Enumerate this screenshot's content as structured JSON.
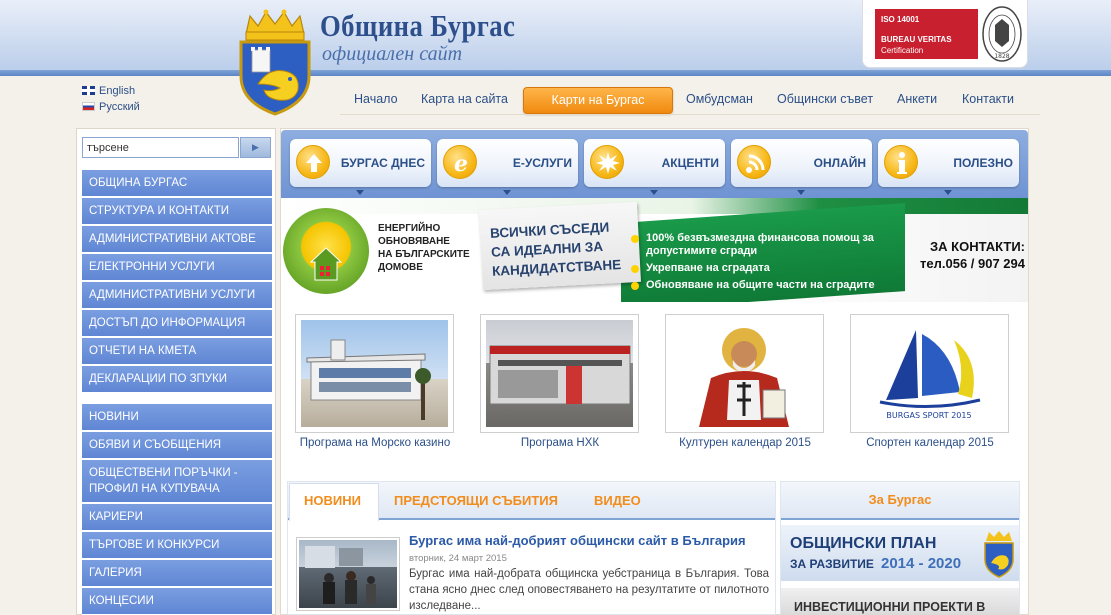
{
  "header": {
    "title": "Община Бургас",
    "subtitle": "официален сайт",
    "iso": {
      "line1": "ISO 14001",
      "line2": "BUREAU VERITAS",
      "line3": "Certification",
      "seal_year": "1828",
      "red": "#c8202f"
    }
  },
  "languages": [
    {
      "label": "English",
      "icon": "uk-flag-icon"
    },
    {
      "label": "Русский",
      "icon": "russia-flag-icon"
    }
  ],
  "topnav": {
    "items": [
      "Начало",
      "Карта на сайта",
      "Карти на Бургас",
      "Омбудсман",
      "Общински съвет",
      "Анкети",
      "Контакти"
    ],
    "highlight_color": "#f08a0f"
  },
  "search": {
    "value": "търсене",
    "button_icon": "arrow-right-icon"
  },
  "sidebar": {
    "group1": [
      "Община Бургас",
      "Структура и контакти",
      "Административни актове",
      "Електронни услуги",
      "Административни услуги",
      "Достъп до информация",
      "Отчети на кмета",
      "Декларации по ЗПУКИ"
    ],
    "group2": [
      "Новини",
      "Обяви и съобщения",
      "Обществени поръчки - профил на купувача",
      "Кариери",
      "Търгове и конкурси",
      "Галерия",
      "Концесии"
    ],
    "accent": "#6a8fd9"
  },
  "categories": [
    {
      "label": "Бургас днес",
      "icon": "arrow-up-icon"
    },
    {
      "label": "E-услуги",
      "icon": "e-letter-icon"
    },
    {
      "label": "Акценти",
      "icon": "burst-icon"
    },
    {
      "label": "Онлайн",
      "icon": "wifi-icon"
    },
    {
      "label": "Полезно",
      "icon": "info-icon"
    }
  ],
  "banner": {
    "logo_text_lines": [
      "ЕНЕРГИЙНО",
      "ОБНОВЯВАНЕ",
      "НА БЪЛГАРСКИТЕ",
      "ДОМОВЕ"
    ],
    "card_lines": [
      "ВСИЧКИ СЪСЕДИ",
      "СА ИДЕАЛНИ ЗА",
      "КАНДИДАТСТВАНЕ"
    ],
    "bullets": [
      "100% безвъзмездна финансова помощ за допустимите сгради",
      "Укрепване на сградата",
      "Обновяване на общите части на сградите"
    ],
    "contact_label": "ЗА КОНТАКТИ:",
    "contact_phone": "тел.056 / 907 294"
  },
  "thumbnails": [
    {
      "caption": "Програма на Морско казино"
    },
    {
      "caption": "Програма НХК"
    },
    {
      "caption": "Културен календар 2015"
    },
    {
      "caption": "Спортен календар 2015",
      "logo_text": "BURGAS SPORT 2015"
    }
  ],
  "tabs": [
    "Новини",
    "Предстоящи събития",
    "Видео"
  ],
  "news": {
    "title": "Бургас има най-добрият общински сайт в България",
    "date": "вторник, 24 март 2015",
    "text": "Бургас има най-добрата общинска уебстраница в България. Това стана ясно днес след оповестяването на резултатите от пилотното изследване..."
  },
  "right": {
    "heading": "За Бургас",
    "plan_line1": "ОБЩИНСКИ ПЛАН",
    "plan_line2": "ЗА РАЗВИТИЕ",
    "plan_years": "2014 - 2020",
    "invest": "ИНВЕСТИЦИОННИ ПРОЕКТИ В"
  }
}
